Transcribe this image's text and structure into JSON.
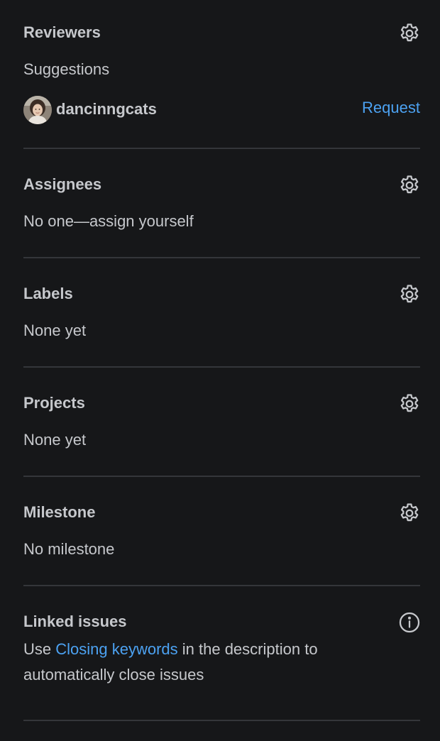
{
  "reviewers": {
    "title": "Reviewers",
    "suggestions_label": "Suggestions",
    "suggested_user": "dancinngcats",
    "request_label": "Request"
  },
  "assignees": {
    "title": "Assignees",
    "value": "No one—assign yourself"
  },
  "labels": {
    "title": "Labels",
    "value": "None yet"
  },
  "projects": {
    "title": "Projects",
    "value": "None yet"
  },
  "milestone": {
    "title": "Milestone",
    "value": "No milestone"
  },
  "linked_issues": {
    "title": "Linked issues",
    "text_before": "Use ",
    "link_text": "Closing keywords",
    "text_after": " in the description to automatically close issues"
  },
  "icons": {
    "settings": "gear-icon",
    "info": "info-icon"
  },
  "colors": {
    "background": "#161719",
    "text": "#c6c8cc",
    "link": "#4ca2f2",
    "divider": "#34363a"
  }
}
